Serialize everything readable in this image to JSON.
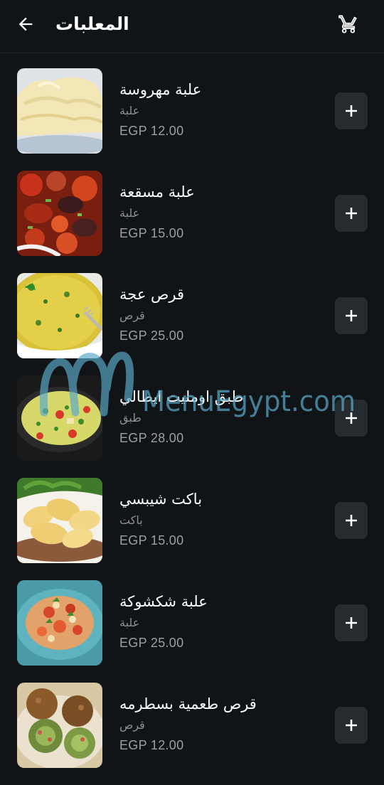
{
  "header": {
    "title": "المعلبات",
    "back_icon": "arrow-left-icon",
    "cart_icon": "shopping-cart-icon"
  },
  "items": [
    {
      "name": "علبة مهروسة",
      "unit": "علبة",
      "price": "EGP 12.00",
      "image": "mashed-potatoes"
    },
    {
      "name": "علبة مسقعة",
      "unit": "علبة",
      "price": "EGP 15.00",
      "image": "moussaka"
    },
    {
      "name": "قرص عجة",
      "unit": "قرص",
      "price": "EGP 25.00",
      "image": "omelette-disc"
    },
    {
      "name": "طبق اومليت ايطالي",
      "unit": "طبق",
      "price": "EGP 28.00",
      "image": "italian-omelette"
    },
    {
      "name": "باكت شيبسي",
      "unit": "باكت",
      "price": "EGP 15.00",
      "image": "potato-chips"
    },
    {
      "name": "علبة شكشوكة",
      "unit": "علبة",
      "price": "EGP 25.00",
      "image": "shakshuka"
    },
    {
      "name": "قرص طعمية بسطرمه",
      "unit": "قرص",
      "price": "EGP 12.00",
      "image": "taameya"
    }
  ],
  "add_icon": "plus-icon",
  "watermark": "MenuEgypt.com",
  "colors": {
    "background": "#101417",
    "button_bg": "#262b30",
    "text_primary": "#ffffff",
    "text_secondary": "#8a9096",
    "watermark": "#5aa9c9"
  }
}
